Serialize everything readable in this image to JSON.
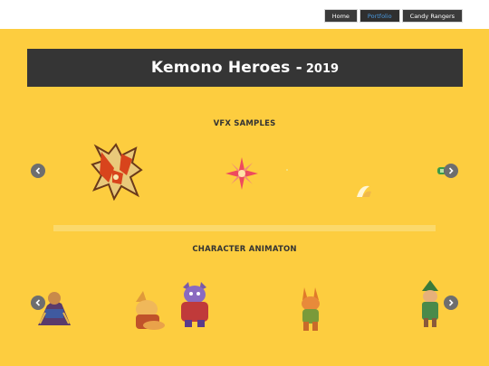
{
  "nav": {
    "items": [
      {
        "label": "Home"
      },
      {
        "label": "Portfolio"
      },
      {
        "label": "Candy Rangers"
      }
    ]
  },
  "banner": {
    "title": "Kemono Heroes -",
    "year": "2019"
  },
  "sections": {
    "vfx": {
      "heading": "VFX SAMPLES"
    },
    "character": {
      "heading": "CHARACTER ANIMATON"
    }
  },
  "colors": {
    "background": "#fdcd3f",
    "banner": "#353535",
    "nav": "#3b3b3b",
    "nav_active_text": "#4a9ae0",
    "arrow": "#6e6e6e"
  },
  "icons": {
    "prev": "chevron-left-icon",
    "next": "chevron-right-icon"
  }
}
